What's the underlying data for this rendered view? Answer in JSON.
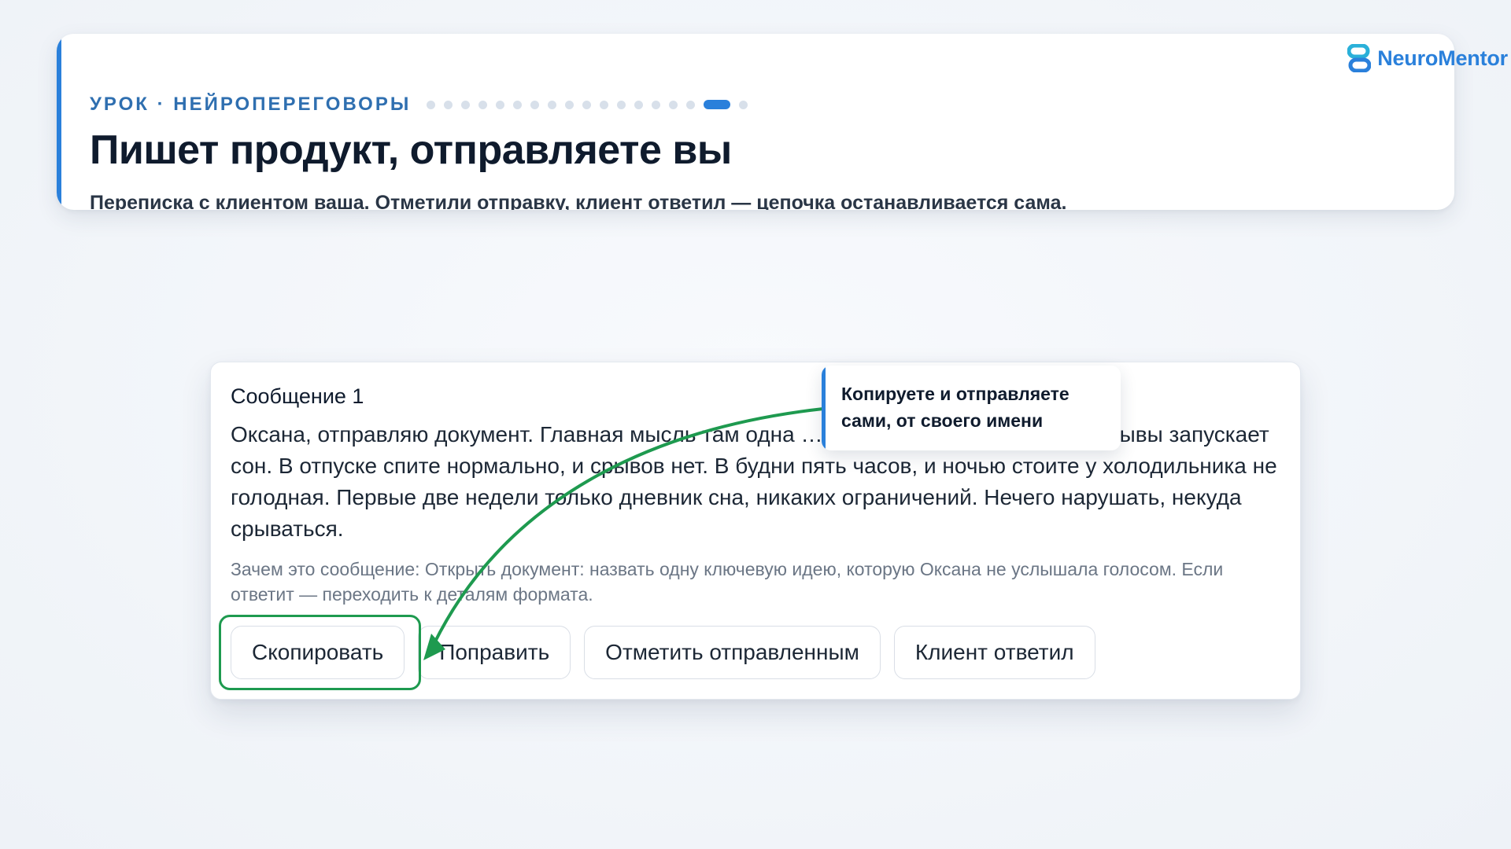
{
  "header": {
    "eyebrow": "УРОК · НЕЙРОПЕРЕГОВОРЫ",
    "progress": {
      "total_steps": 18,
      "current_step": 17
    },
    "title": "Пишет продукт, отправляете вы",
    "subtitle": "Переписка с клиентом ваша. Отметили отправку, клиент ответил — цепочка останавливается сама."
  },
  "logo": {
    "text": "NeuroMentor",
    "icon": "neuromentor-logo-icon",
    "color": "#2a80db"
  },
  "message": {
    "title": "Сообщение 1",
    "body": "Оксана, отправляю документ. Главная мысль там одна … чтобы работали с едой, а срывы запускает сон. В отпуске спите нормально, и срывов нет. В будни пять часов, и ночью стоите у холодильника не голодная. Первые две недели только дневник сна, никаких ограничений. Нечего нарушать, некуда срываться.",
    "hint": "Зачем это сообщение: Открыть документ: назвать одну ключевую идею, которую Оксана не услышала голосом. Если ответит — переходить к деталям формата.",
    "buttons": {
      "copy": "Скопировать",
      "edit": "Поправить",
      "mark_sent": "Отметить отправленным",
      "client_replied": "Клиент ответил"
    }
  },
  "callout": {
    "text": "Копируете и отправляете сами, от своего имени"
  },
  "colors": {
    "accent": "#2a80db",
    "highlight": "#1e9a4f",
    "eyebrow": "#2f6fb0"
  }
}
